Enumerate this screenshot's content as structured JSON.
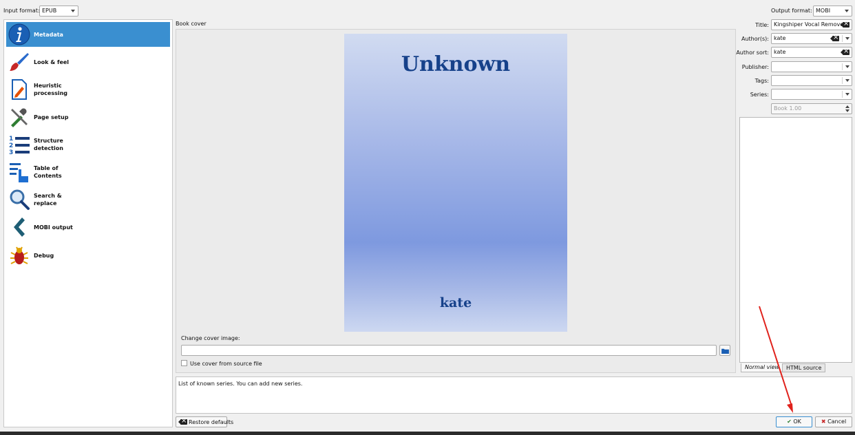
{
  "top_bar": {
    "input_format_label": "Input format:",
    "input_format_value": "EPUB",
    "output_format_label": "Output format:",
    "output_format_value": "MOBI"
  },
  "sidebar": {
    "items": [
      {
        "label": "Metadata",
        "icon": "info-icon",
        "active": true
      },
      {
        "label": "Look & feel",
        "icon": "paintbrush-icon"
      },
      {
        "label": "Heuristic processing",
        "icon": "document-edit-icon"
      },
      {
        "label": "Page setup",
        "icon": "tools-icon"
      },
      {
        "label": "Structure detection",
        "icon": "numbered-list-icon"
      },
      {
        "label": "Table of Contents",
        "icon": "toc-hand-icon"
      },
      {
        "label": "Search & replace",
        "icon": "magnifier-icon"
      },
      {
        "label": "MOBI output",
        "icon": "chevron-left-icon"
      },
      {
        "label": "Debug",
        "icon": "bug-icon"
      }
    ]
  },
  "cover": {
    "section_label": "Book cover",
    "title": "Unknown",
    "author": "kate",
    "change_label": "Change cover image:",
    "path_value": "",
    "use_source_label": "Use cover from source file"
  },
  "metadata": {
    "title_label": "Title:",
    "title_value": "Kingshiper Vocal Remover",
    "authors_label": "Author(s):",
    "authors_value": "kate",
    "author_sort_label": "Author sort:",
    "author_sort_value": "kate",
    "publisher_label": "Publisher:",
    "publisher_value": "",
    "tags_label": "Tags:",
    "tags_value": "",
    "series_label": "Series:",
    "series_value": "",
    "series_index": "Book 1.00"
  },
  "comments": {
    "tabs": [
      "Normal view",
      "HTML source"
    ]
  },
  "help_text": "List of known series. You can add new series.",
  "buttons": {
    "restore": "Restore defaults",
    "ok": "OK",
    "cancel": "Cancel"
  },
  "colors": {
    "accent": "#3a8fd0",
    "cover_text": "#16418a",
    "annotation_arrow": "#e0221c"
  }
}
